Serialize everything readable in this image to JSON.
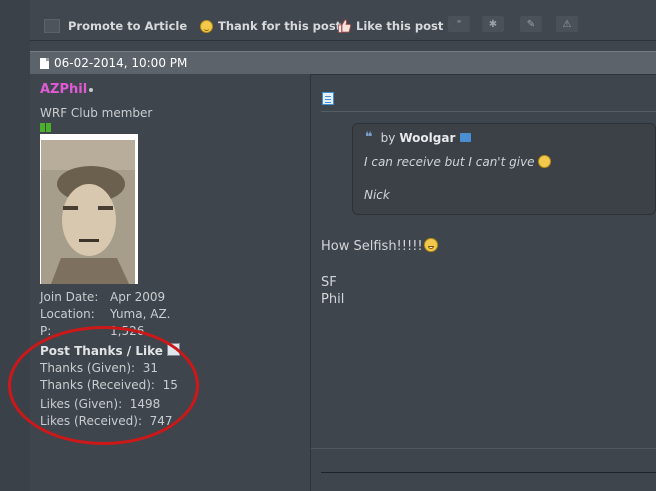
{
  "actionbar": {
    "promote_label": "Promote to Article",
    "thank_label": "Thank for this post",
    "like_label": "Like this post"
  },
  "post_header": {
    "date": "06-02-2014, 10:00 PM"
  },
  "user": {
    "name": "AZPhil",
    "name_color": "#e05ad6",
    "title": "WRF Club member",
    "info": [
      {
        "label": "Join Date:",
        "value": "Apr 2009"
      },
      {
        "label": "Location:",
        "value": "Yuma, AZ."
      },
      {
        "label": "P:",
        "value": "1,526"
      }
    ],
    "thanks_heading": "Post Thanks / Like",
    "stats": [
      {
        "label": "Thanks (Given):",
        "value": "31"
      },
      {
        "label": "Thanks (Received):",
        "value": "15"
      },
      {
        "label": "Likes (Given):",
        "value": "1498"
      },
      {
        "label": "Likes (Received):",
        "value": "747"
      }
    ]
  },
  "quote": {
    "by": "by",
    "author": "Woolgar",
    "line1": "I can receive but I can't give",
    "line2": "Nick"
  },
  "post": {
    "line1": "How Selfish!!!!!",
    "line2": "SF",
    "line3": "Phil"
  },
  "colors": {
    "background": "#3f454c",
    "annotation_circle": "#cc1818"
  }
}
